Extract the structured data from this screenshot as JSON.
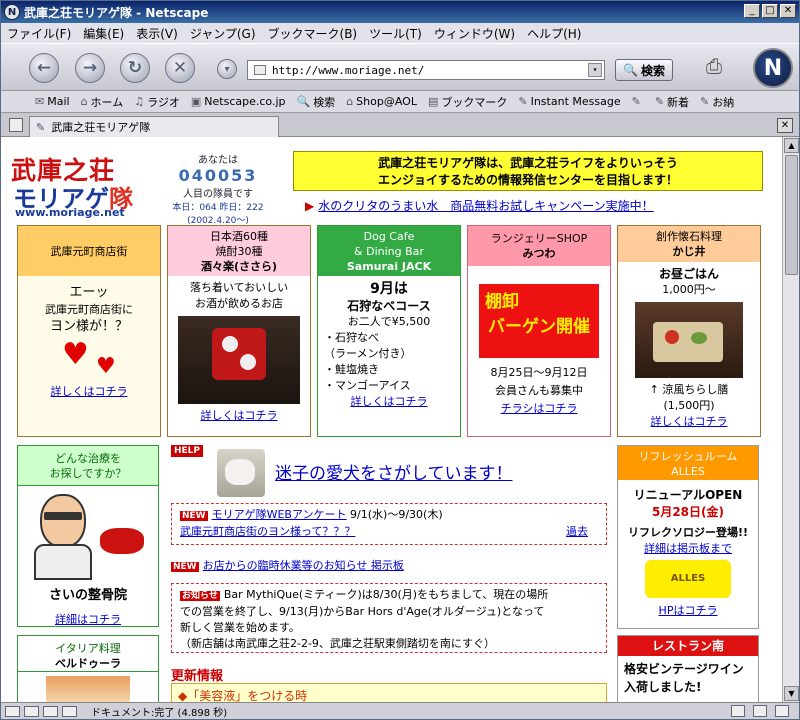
{
  "window": {
    "title": "武庫之荘モリアゲ隊 - Netscape",
    "min": "_",
    "max": "□",
    "close": "✕"
  },
  "menu": [
    "ファイル(F)",
    "編集(E)",
    "表示(V)",
    "ジャンプ(G)",
    "ブックマーク(B)",
    "ツール(T)",
    "ウィンドウ(W)",
    "ヘルプ(H)"
  ],
  "nav": {
    "url": "http://www.moriage.net/",
    "search_label": "検索"
  },
  "personal": [
    "Mail",
    "ホーム",
    "ラジオ",
    "Netscape.co.jp",
    "検索",
    "Shop@AOL",
    "ブックマーク",
    "Instant Message",
    "",
    "新着",
    "お納"
  ],
  "tab": {
    "label": "武庫之荘モリアゲ隊"
  },
  "page": {
    "logo": {
      "line1": "武庫之荘",
      "line2a": "モリアゲ",
      "line2b": "隊",
      "url": "www.moriage.net"
    },
    "counter": {
      "label": "あなたは",
      "digits": "040053",
      "suffix": "人目の隊員です",
      "today": "本日：064 昨日：222",
      "since": "(2002.4.20〜)"
    },
    "banner": {
      "line1": "武庫之荘モリアゲ隊は、武庫之荘ライフをよりいっそう",
      "line2": "エンジョイするための情報発信センターを目指します！"
    },
    "banner_link": "水のクリタのうまい水　商品無料お試しキャンペーン実施中！",
    "shops": [
      {
        "head": [
          "武庫元町商店街"
        ],
        "body": [
          "エーッ",
          "武庫元町商店街に",
          "ヨン様が！？"
        ],
        "link": "詳しくはコチラ"
      },
      {
        "head": [
          "日本酒60種",
          "焼酎30種",
          "酒々楽(ささら)"
        ],
        "body": [
          "落ち着いておいしい",
          "お酒が飲めるお店"
        ],
        "link": "詳しくはコチラ"
      },
      {
        "head": [
          "Dog Cafe",
          "& Dining Bar",
          "Samurai JACK"
        ],
        "body": [
          "9月は",
          "石狩なべコース",
          "お二人で¥5,500",
          "・石狩なべ",
          "（ラーメン付き）",
          "・鮭塩焼き",
          "・マンゴーアイス"
        ],
        "link": "詳しくはコチラ"
      },
      {
        "head": [
          "ランジェリーSHOP",
          "みつわ"
        ],
        "body": [
          "棚卸",
          "バーゲン開催",
          "8月25日〜9月12日",
          "会員さんも募集中"
        ],
        "link": "チラシはコチラ"
      },
      {
        "head": [
          "創作懐石料理",
          "かじ井"
        ],
        "body": [
          "お昼ごはん",
          "1,000円〜",
          "↑ 涼風ちらし膳",
          "(1,500円)"
        ],
        "link": "詳しくはコチラ"
      }
    ],
    "clinic": {
      "head": [
        "どんな治療を",
        "お探しですか？"
      ],
      "name": "さいの整骨院",
      "link": "詳細はコチラ"
    },
    "italy": {
      "head": [
        "イタリア料理",
        "ベルドゥーラ"
      ]
    },
    "help": {
      "tag": "HELP",
      "text": "迷子の愛犬をさがしています！"
    },
    "news1": {
      "tag": "NEW",
      "link": "モリアゲ隊WEBアンケート",
      "date": "9/1(水)〜9/30(木)",
      "link2": "武庫元町商店街のヨン様って？？？",
      "past": "過去"
    },
    "news2": {
      "tag": "NEW",
      "link": "お店からの臨時休業等のお知らせ 掲示板"
    },
    "notice": {
      "tag": "お知らせ",
      "lines": [
        "Bar MythiQue(ミティーク)は8/30(月)をもちまして、現在の場所",
        "での営業を終了し、9/13(月)からBar Hors d'Age(オルダージュ)となって",
        "新しく営業を始めます。",
        "（新店舗は南武庫之荘2-2-9、武庫之荘駅東側踏切を南にすぐ）"
      ]
    },
    "updates": {
      "title": "更新情報",
      "item": "◆「美容液」をつける時"
    },
    "refresh": {
      "head": [
        "リフレッシュルーム",
        "ALLES"
      ],
      "open": "リニューアルOPEN",
      "date": "5月28日(金)",
      "text": "リフレクソロジー登場!!",
      "link1": "詳細は掲示板まで",
      "logo": "ALLES",
      "link2": "HPはコチラ"
    },
    "restaurant": {
      "head": "レストラン南",
      "text": [
        "格安ビンテージワイン",
        "入荷しました!"
      ]
    }
  },
  "status": {
    "text": "ドキュメント:完了 (4.898 秒)"
  },
  "colors": {
    "accent": "#cc0000",
    "link": "#0000cc",
    "banner": "#ffff33"
  }
}
